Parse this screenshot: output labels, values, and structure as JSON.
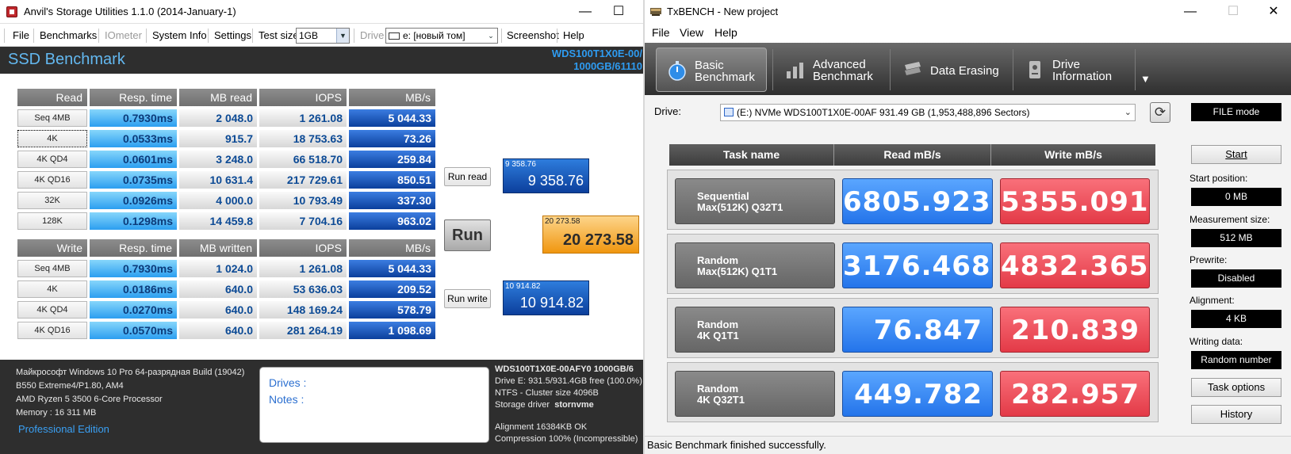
{
  "anvil": {
    "title": "Anvil's Storage Utilities 1.1.0 (2014-January-1)",
    "window_controls": {
      "minimize": "—",
      "maximize": "☐",
      "close": "✕"
    },
    "menu": {
      "file": "File",
      "benchmarks": "Benchmarks",
      "iometer": "IOmeter",
      "system_info": "System Info",
      "settings": "Settings",
      "test_size_label": "Test size",
      "test_size_value": "1GB",
      "drive_label": "Drive",
      "drive_value": "e: [новый том]",
      "screenshot": "Screenshot",
      "help": "Help"
    },
    "header": {
      "title": "SSD Benchmark",
      "drive_line1": "WDS100T1X0E-00/",
      "drive_line2": "1000GB/61110"
    },
    "read_table": {
      "headers": [
        "Read",
        "Resp. time",
        "MB read",
        "IOPS",
        "MB/s"
      ],
      "rows": [
        {
          "label": "Seq 4MB",
          "resp": "0.7930ms",
          "mb": "2 048.0",
          "iops": "1 261.08",
          "mbs": "5 044.33"
        },
        {
          "label": "4K",
          "resp": "0.0533ms",
          "mb": "915.7",
          "iops": "18 753.63",
          "mbs": "73.26"
        },
        {
          "label": "4K QD4",
          "resp": "0.0601ms",
          "mb": "3 248.0",
          "iops": "66 518.70",
          "mbs": "259.84"
        },
        {
          "label": "4K QD16",
          "resp": "0.0735ms",
          "mb": "10 631.4",
          "iops": "217 729.61",
          "mbs": "850.51"
        },
        {
          "label": "32K",
          "resp": "0.0926ms",
          "mb": "4 000.0",
          "iops": "10 793.49",
          "mbs": "337.30"
        },
        {
          "label": "128K",
          "resp": "0.1298ms",
          "mb": "14 459.8",
          "iops": "7 704.16",
          "mbs": "963.02"
        }
      ]
    },
    "write_table": {
      "headers": [
        "Write",
        "Resp. time",
        "MB written",
        "IOPS",
        "MB/s"
      ],
      "rows": [
        {
          "label": "Seq 4MB",
          "resp": "0.7930ms",
          "mb": "1 024.0",
          "iops": "1 261.08",
          "mbs": "5 044.33"
        },
        {
          "label": "4K",
          "resp": "0.0186ms",
          "mb": "640.0",
          "iops": "53 636.03",
          "mbs": "209.52"
        },
        {
          "label": "4K QD4",
          "resp": "0.0270ms",
          "mb": "640.0",
          "iops": "148 169.24",
          "mbs": "578.79"
        },
        {
          "label": "4K QD16",
          "resp": "0.0570ms",
          "mb": "640.0",
          "iops": "281 264.19",
          "mbs": "1 098.69"
        }
      ]
    },
    "buttons": {
      "run_read": "Run read",
      "run": "Run",
      "run_write": "Run write"
    },
    "scores": {
      "read_small": "9 358.76",
      "read_big": "9 358.76",
      "total_small": "20 273.58",
      "total_big": "20 273.58",
      "write_small": "10 914.82",
      "write_big": "10 914.82"
    },
    "sysinfo": {
      "os": "Майкрософт Windows 10 Pro 64-разрядная Build (19042)",
      "board": "B550 Extreme4/P1.80, AM4",
      "cpu": "AMD Ryzen 5 3500 6-Core Processor",
      "memory": "Memory : 16 311 MB",
      "edition": "Professional Edition"
    },
    "notes": {
      "drives": "Drives :",
      "notes": "Notes :"
    },
    "driveinfo": {
      "title": "WDS100T1X0E-00AFY0 1000GB/6",
      "line1": "Drive E: 931.5/931.4GB free (100.0%)",
      "line2": "NTFS - Cluster size 4096B",
      "line3_label": "Storage driver",
      "line3_value": "stornvme",
      "line4": "Alignment 16384KB OK",
      "line5": "Compression 100% (Incompressible)"
    }
  },
  "txbench": {
    "title": "TxBENCH - New project",
    "window_controls": {
      "minimize": "—",
      "maximize": "☐",
      "close": "✕"
    },
    "menu": {
      "file": "File",
      "view": "View",
      "help": "Help"
    },
    "tabs": [
      {
        "label": "Basic\nBenchmark"
      },
      {
        "label": "Advanced\nBenchmark"
      },
      {
        "label": "Data Erasing"
      },
      {
        "label": "Drive\nInformation"
      }
    ],
    "drive_label": "Drive:",
    "drive_value": "(E:) NVMe WDS100T1X0E-00AF  931.49 GB (1,953,488,896 Sectors)",
    "file_mode": "FILE mode",
    "table_headers": {
      "name": "Task name",
      "read": "Read mB/s",
      "write": "Write mB/s"
    },
    "rows": [
      {
        "name": "Sequential\nMax(512K) Q32T1",
        "read": "6805.923",
        "write": "5355.091"
      },
      {
        "name": "Random\nMax(512K) Q1T1",
        "read": "3176.468",
        "write": "4832.365"
      },
      {
        "name": "Random\n4K Q1T1",
        "read": "76.847",
        "write": "210.839"
      },
      {
        "name": "Random\n4K Q32T1",
        "read": "449.782",
        "write": "282.957"
      }
    ],
    "side": {
      "start": "Start",
      "start_position_label": "Start position:",
      "start_position": "0 MB",
      "measurement_size_label": "Measurement size:",
      "measurement_size": "512 MB",
      "prewrite_label": "Prewrite:",
      "prewrite": "Disabled",
      "alignment_label": "Alignment:",
      "alignment": "4 KB",
      "writing_data_label": "Writing data:",
      "writing_data": "Random number",
      "task_options": "Task options",
      "history": "History"
    },
    "status": "Basic Benchmark finished successfully."
  },
  "colors": {
    "anvil_dark": "#2e2e2e",
    "anvil_header_text": "#63b8f0",
    "resp_cyan": "#2c9ef0",
    "mbs_blue": "#0b3f9c",
    "total_orange": "#f0960f",
    "tx_read_blue": "#2474ea",
    "tx_write_red": "#e33a47"
  },
  "icons": [
    "app-icon",
    "dropdown-arrow-icon",
    "drive-icon",
    "stopwatch-icon",
    "bar-chart-icon",
    "eraser-icon",
    "disk-info-icon",
    "refresh-icon",
    "more-arrow-icon"
  ]
}
